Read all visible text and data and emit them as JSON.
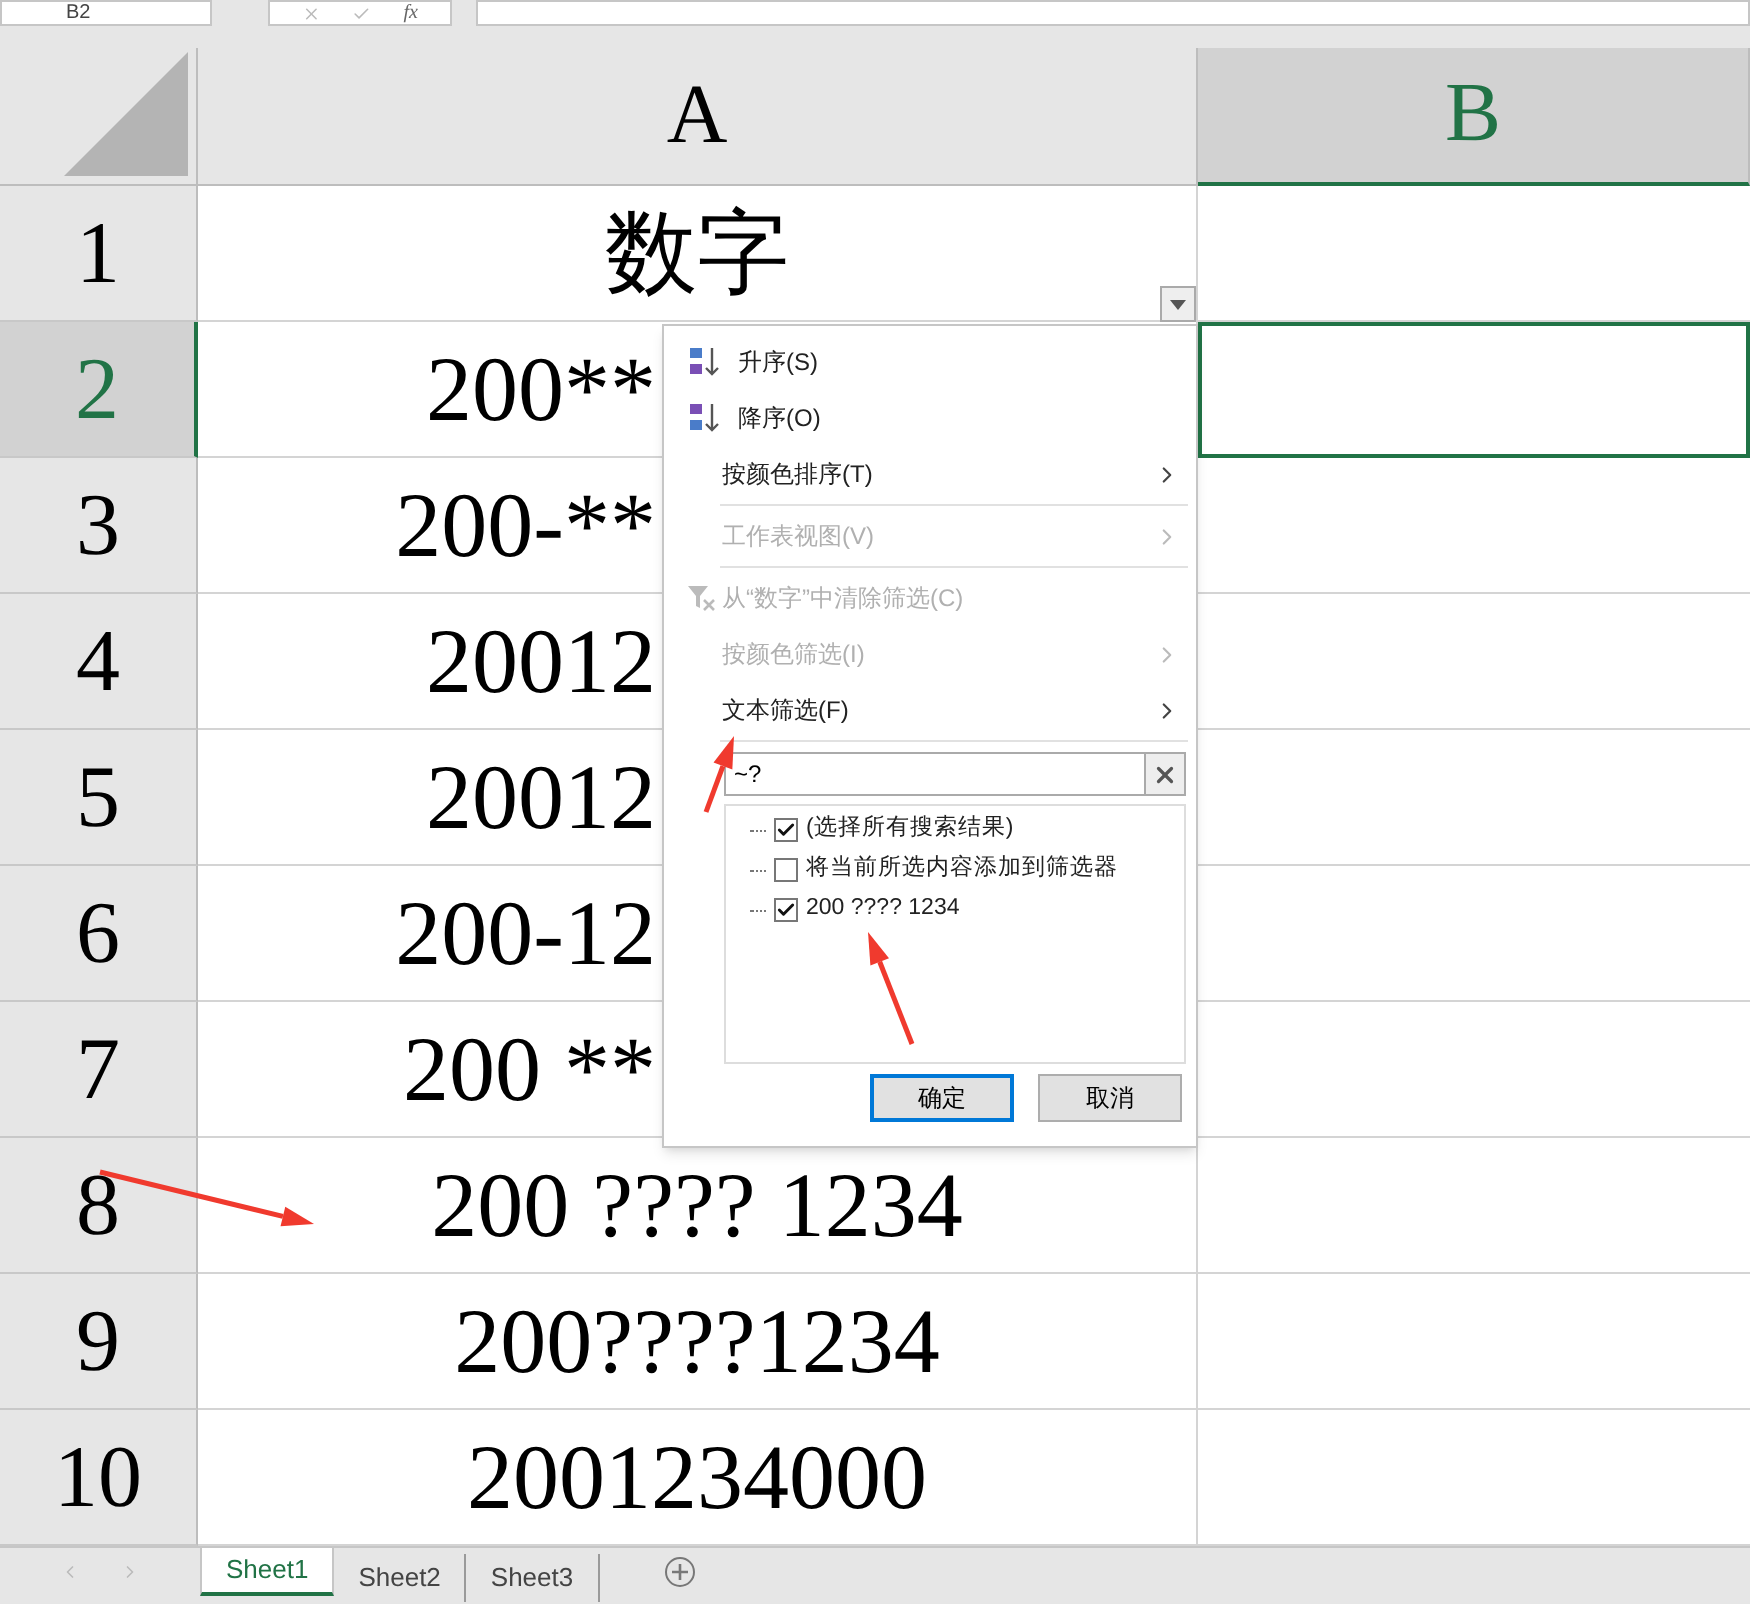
{
  "formula_bar": {
    "name_box": "B2",
    "fx": "fx"
  },
  "columns": [
    {
      "label": "A",
      "selected": false
    },
    {
      "label": "B",
      "selected": true
    }
  ],
  "rows": [
    {
      "number": "1",
      "selected": false,
      "kind": "full",
      "cell_a": "数字",
      "cell_b_selected": false
    },
    {
      "number": "2",
      "selected": true,
      "kind": "covered",
      "cell_a": "200**",
      "cell_b_selected": true
    },
    {
      "number": "3",
      "selected": false,
      "kind": "covered",
      "cell_a": "200-**",
      "cell_b_selected": false
    },
    {
      "number": "4",
      "selected": false,
      "kind": "covered",
      "cell_a": "20012",
      "cell_b_selected": false
    },
    {
      "number": "5",
      "selected": false,
      "kind": "covered",
      "cell_a": "20012",
      "cell_b_selected": false
    },
    {
      "number": "6",
      "selected": false,
      "kind": "covered",
      "cell_a": "200-12",
      "cell_b_selected": false
    },
    {
      "number": "7",
      "selected": false,
      "kind": "covered",
      "cell_a": "200  **",
      "cell_b_selected": false
    },
    {
      "number": "8",
      "selected": false,
      "kind": "full",
      "cell_a": "200  ????  1234",
      "cell_b_selected": false
    },
    {
      "number": "9",
      "selected": false,
      "kind": "full",
      "cell_a": "200????1234",
      "cell_b_selected": false
    },
    {
      "number": "10",
      "selected": false,
      "kind": "full",
      "cell_a": "2001234000",
      "cell_b_selected": false
    }
  ],
  "filter_menu": {
    "items": [
      {
        "kind": "sort_asc",
        "label": "升序(S)",
        "disabled": false
      },
      {
        "kind": "sort_desc",
        "label": "降序(O)",
        "disabled": false
      },
      {
        "kind": "submenu",
        "label": "按颜色排序(T)",
        "disabled": false
      },
      {
        "kind": "separator"
      },
      {
        "kind": "submenu",
        "label": "工作表视图(V)",
        "disabled": true
      },
      {
        "kind": "separator"
      },
      {
        "kind": "clear",
        "label": "从“数字”中清除筛选(C)",
        "disabled": true
      },
      {
        "kind": "submenu",
        "label": "按颜色筛选(I)",
        "disabled": true
      },
      {
        "kind": "submenu",
        "label": "文本筛选(F)",
        "disabled": false
      },
      {
        "kind": "separator"
      }
    ],
    "search": {
      "value": "~?"
    },
    "list": [
      {
        "label": "(选择所有搜索结果)",
        "checked": true
      },
      {
        "label": "将当前所选内容添加到筛选器",
        "checked": false
      },
      {
        "label": "200 ???? 1234",
        "checked": true
      }
    ],
    "buttons": [
      {
        "label": "确定",
        "selected": true
      },
      {
        "label": "取消",
        "selected": false
      }
    ]
  },
  "sheet_tabs": [
    {
      "label": "Sheet1",
      "selected": true
    },
    {
      "label": "Sheet2",
      "selected": false
    },
    {
      "label": "Sheet3",
      "selected": false
    }
  ]
}
